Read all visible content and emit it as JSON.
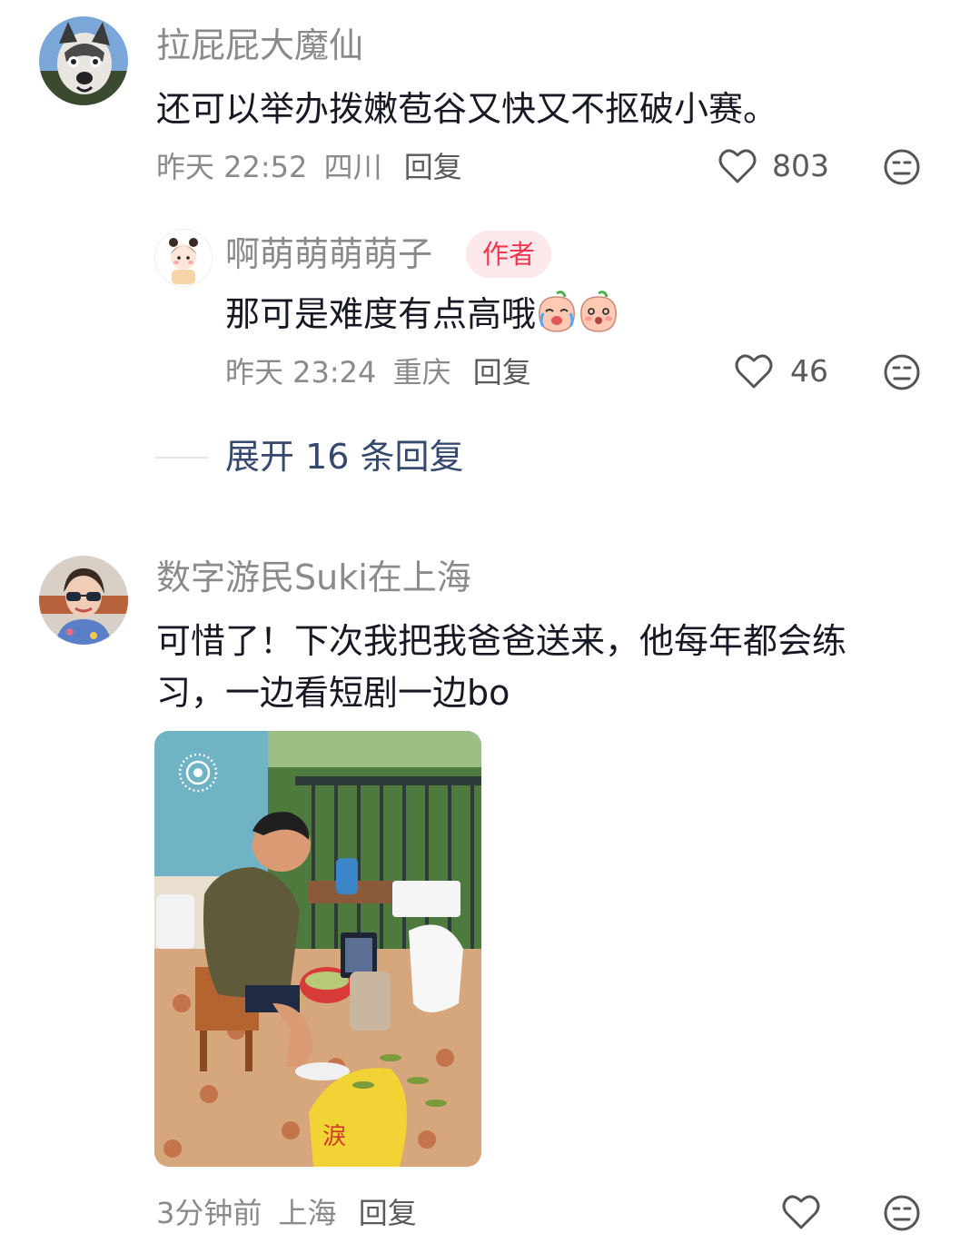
{
  "comments": [
    {
      "username": "拉屁屁大魔仙",
      "text": "还可以举办拨嫩苞谷又快又不抠破小赛。",
      "time": "昨天 22:52",
      "location": "四川",
      "reply_label": "回复",
      "likes": "803",
      "avatar_icon": "husky-dog-avatar",
      "replies": [
        {
          "username": "啊萌萌萌萌子",
          "badge": "作者",
          "text": "那可是难度有点高哦",
          "time": "昨天 23:24",
          "location": "重庆",
          "reply_label": "回复",
          "likes": "46",
          "avatar_icon": "cartoon-girl-avatar",
          "emojis": [
            "crying-peach-emoji",
            "shy-peach-emoji"
          ]
        }
      ],
      "expand_label": "展开 16 条回复"
    },
    {
      "username": "数字游民Suki在上海",
      "text_line1": "可惜了！下次我把我爸爸送来，他每年都会练",
      "text_line2": "习，一边看短剧一边bo",
      "time": "3分钟前",
      "location": "上海",
      "reply_label": "回复",
      "likes": "",
      "avatar_icon": "woman-sunglasses-avatar",
      "photo": {
        "icon": "live-photo-icon",
        "description_icon": "man-shelling-beans-photo"
      }
    }
  ],
  "colors": {
    "name": "#8a8a8a",
    "text": "#161823",
    "badge_bg": "#fde8eb",
    "badge_text": "#f2364f",
    "expand": "#35486e"
  }
}
